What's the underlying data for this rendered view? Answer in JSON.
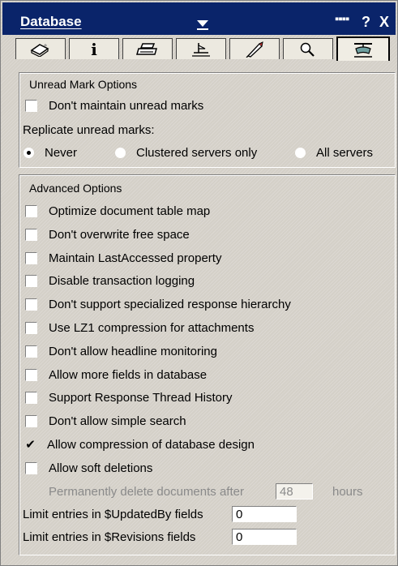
{
  "window": {
    "title": "Database"
  },
  "titlebar_icons": {
    "dots": "▪▪▪▪",
    "help": "?",
    "close": "X"
  },
  "tabs": [
    {
      "icon": "info-book-icon",
      "selected": false
    },
    {
      "icon": "info-icon",
      "selected": false,
      "glyph": "i"
    },
    {
      "icon": "printer-icon",
      "selected": false
    },
    {
      "icon": "design-icon",
      "selected": false
    },
    {
      "icon": "launch-icon",
      "selected": false
    },
    {
      "icon": "full-text-search-icon",
      "selected": false
    },
    {
      "icon": "advanced-propeller-icon",
      "selected": true
    }
  ],
  "unread": {
    "title": "Unread Mark Options",
    "dont_maintain": {
      "label": "Don't maintain unread marks",
      "checked": false
    },
    "replicate_label": "Replicate unread marks:",
    "options": [
      {
        "label": "Never",
        "selected": true
      },
      {
        "label": "Clustered servers only",
        "selected": false
      },
      {
        "label": "All servers",
        "selected": false
      }
    ]
  },
  "advanced": {
    "title": "Advanced Options",
    "options": [
      {
        "label": "Optimize document table map",
        "checked": false
      },
      {
        "label": "Don't overwrite free space",
        "checked": false
      },
      {
        "label": "Maintain LastAccessed property",
        "checked": false
      },
      {
        "label": "Disable transaction logging",
        "checked": false
      },
      {
        "label": "Don't support specialized response hierarchy",
        "checked": false
      },
      {
        "label": "Use LZ1 compression for attachments",
        "checked": false
      },
      {
        "label": "Don't allow headline monitoring",
        "checked": false
      },
      {
        "label": "Allow more fields in database",
        "checked": false
      },
      {
        "label": "Support Response Thread History",
        "checked": false
      },
      {
        "label": "Don't allow simple search",
        "checked": false
      },
      {
        "label": "Allow compression of database design",
        "checked": true
      },
      {
        "label": "Allow soft deletions",
        "checked": false
      }
    ],
    "permanent_delete_label": "Permanently delete documents after",
    "permanent_delete_value": "48",
    "permanent_delete_unit": "hours",
    "updatedby_label": "Limit entries in $UpdatedBy fields",
    "updatedby_value": "0",
    "revisions_label": "Limit entries in $Revisions fields",
    "revisions_value": "0"
  },
  "check_glyph": "✔"
}
